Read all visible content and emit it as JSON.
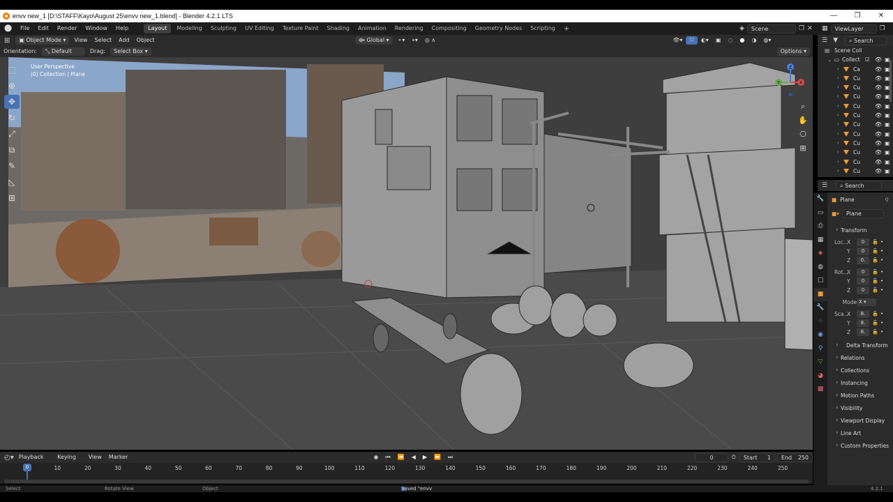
{
  "window": {
    "title": "envv new_1 [D:\\STAFF\\Kayo\\August 25\\envv new_1.blend] - Blender 4.2.1 LTS",
    "controls": [
      "—",
      "❐",
      "✕"
    ]
  },
  "menu": [
    "File",
    "Edit",
    "Render",
    "Window",
    "Help"
  ],
  "workspaces": [
    "Layout",
    "Modeling",
    "Sculpting",
    "UV Editing",
    "Texture Paint",
    "Shading",
    "Animation",
    "Rendering",
    "Compositing",
    "Geometry Nodes",
    "Scripting"
  ],
  "active_workspace": "Layout",
  "scene": "Scene",
  "view_layer": "ViewLayer",
  "viewport_header": {
    "mode": "Object Mode",
    "menus": [
      "View",
      "Select",
      "Add",
      "Object"
    ],
    "transform": "Global"
  },
  "tool_settings": {
    "orientation_label": "Orientation:",
    "orientation": "Default",
    "drag_label": "Drag:",
    "drag": "Select Box",
    "options": "Options"
  },
  "viewport_info": {
    "perspective": "User Perspective",
    "collection": "(0) Collection | Plane"
  },
  "gizmo": {
    "x": "X",
    "y": "Y",
    "z": "Z"
  },
  "outliner": {
    "search": "Search",
    "scene_collection": "Scene Coll",
    "collection": "Collect",
    "items": [
      "Ca",
      "Cu",
      "Cu",
      "Cu",
      "Cu",
      "Cu",
      "Cu",
      "Cu",
      "Cu",
      "Cu",
      "Cu",
      "Cu"
    ]
  },
  "properties": {
    "search": "Search",
    "object_name": "Plane",
    "data_name": "Plane",
    "transform": "Transform",
    "location_label": "Loc...",
    "rotation_label": "Rot...",
    "mode_label": "Mode",
    "mode_value": "X",
    "scale_label": "Sca...",
    "loc": [
      "0",
      "0",
      "0."
    ],
    "rot": [
      "0",
      "0",
      "0"
    ],
    "scale": [
      "8.",
      "8.",
      "8."
    ],
    "axes": [
      "X",
      "Y",
      "Z"
    ],
    "delta": "Delta Transform",
    "panels": [
      "Relations",
      "Collections",
      "Instancing",
      "Motion Paths",
      "Visibility",
      "Viewport Display",
      "Line Art",
      "Custom Properties"
    ]
  },
  "timeline": {
    "menus": [
      "Playback",
      "Keying",
      "View",
      "Marker"
    ],
    "current_frame": "0",
    "start_label": "Start",
    "start": "1",
    "end_label": "End",
    "end": "250",
    "ticks": [
      "0",
      "10",
      "20",
      "30",
      "40",
      "50",
      "60",
      "70",
      "80",
      "90",
      "100",
      "110",
      "120",
      "130",
      "140",
      "150",
      "160",
      "170",
      "180",
      "190",
      "200",
      "210",
      "220",
      "230",
      "240",
      "250"
    ]
  },
  "status": {
    "select": "Select",
    "rotate": "Rotate View",
    "object": "Object",
    "saved": "Saved \"envv new_1.blend\"",
    "version": "4.2.1"
  },
  "colors": {
    "accent": "#4772b3",
    "header": "#2b2b2b",
    "viewport": "#3e3e3e",
    "mesh_icon": "#e89a3c"
  }
}
